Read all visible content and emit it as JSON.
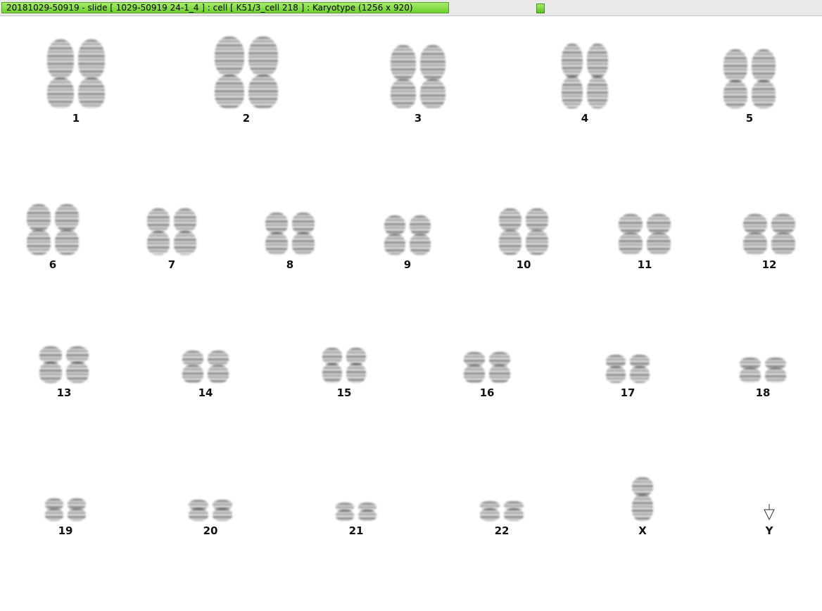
{
  "window": {
    "title": "20181029-50919 - slide [ 1029-50919 24-1_4 ] : cell [ K51/3_cell 218 ] : Karyotype  (1256 x 920)"
  },
  "karyotype": {
    "rows": [
      [
        {
          "label": "1",
          "copies": 2
        },
        {
          "label": "2",
          "copies": 2
        },
        {
          "label": "3",
          "copies": 2
        },
        {
          "label": "4",
          "copies": 2
        },
        {
          "label": "5",
          "copies": 2
        }
      ],
      [
        {
          "label": "6",
          "copies": 2
        },
        {
          "label": "7",
          "copies": 2
        },
        {
          "label": "8",
          "copies": 2
        },
        {
          "label": "9",
          "copies": 2
        },
        {
          "label": "10",
          "copies": 2
        },
        {
          "label": "11",
          "copies": 2
        },
        {
          "label": "12",
          "copies": 2
        }
      ],
      [
        {
          "label": "13",
          "copies": 2
        },
        {
          "label": "14",
          "copies": 2
        },
        {
          "label": "15",
          "copies": 2
        },
        {
          "label": "16",
          "copies": 2
        },
        {
          "label": "17",
          "copies": 2
        },
        {
          "label": "18",
          "copies": 2
        }
      ],
      [
        {
          "label": "19",
          "copies": 2
        },
        {
          "label": "20",
          "copies": 2
        },
        {
          "label": "21",
          "copies": 2
        },
        {
          "label": "22",
          "copies": 2
        },
        {
          "label": "X",
          "copies": 1
        },
        {
          "label": "Y",
          "copies": 0
        }
      ]
    ]
  },
  "icons": {
    "pointer": "arrow-pointer-icon"
  },
  "colors": {
    "title_bar": "#7ed63e",
    "chromosome": "#5a5a5a",
    "label": "#111111",
    "background": "#ffffff"
  }
}
